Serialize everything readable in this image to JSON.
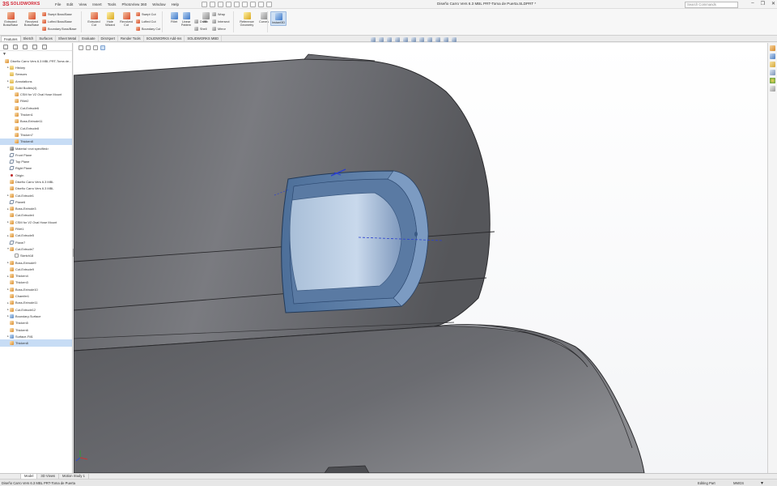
{
  "app": {
    "brand": "SOLIDWORKS",
    "document_title": "Diseño Carro Vers 6.3 MBL PRT-Toma de Puerta.SLDPRT *",
    "search_placeholder": "Search Commands",
    "win_minimize": "–",
    "win_restore": "❐",
    "win_close": "✕",
    "accent_color": "#d2202f"
  },
  "menu": [
    "File",
    "Edit",
    "View",
    "Insert",
    "Tools",
    "PhotoView 360",
    "Window",
    "Help"
  ],
  "ribbon": {
    "buttons": [
      {
        "label": "Extruded Boss/Base",
        "icon": "extrude-boss-icon"
      },
      {
        "label": "Revolved Boss/Base",
        "icon": "revolve-boss-icon"
      },
      {
        "label": "Extruded Cut",
        "icon": "extrude-cut-icon"
      },
      {
        "label": "Hole Wizard",
        "icon": "hole-wizard-icon"
      },
      {
        "label": "Revolved Cut",
        "icon": "revolve-cut-icon"
      },
      {
        "label": "Fillet",
        "icon": "fillet-icon"
      },
      {
        "label": "Linear Pattern",
        "icon": "linear-pattern-icon"
      },
      {
        "label": "Rib",
        "icon": "rib-icon"
      },
      {
        "label": "Reference Geometry",
        "icon": "reference-geometry-icon"
      },
      {
        "label": "Curves",
        "icon": "curves-icon"
      },
      {
        "label": "Instant3D",
        "icon": "instant3d-icon"
      }
    ],
    "small": [
      {
        "label": "Swept Boss/Base",
        "icon": "swept-boss-icon"
      },
      {
        "label": "Lofted Boss/Base",
        "icon": "lofted-boss-icon"
      },
      {
        "label": "Boundary Boss/Base",
        "icon": "boundary-boss-icon"
      },
      {
        "label": "Swept Cut",
        "icon": "swept-cut-icon"
      },
      {
        "label": "Lofted Cut",
        "icon": "lofted-cut-icon"
      },
      {
        "label": "Boundary Cut",
        "icon": "boundary-cut-icon"
      },
      {
        "label": "Draft",
        "icon": "draft-icon"
      },
      {
        "label": "Shell",
        "icon": "shell-icon"
      },
      {
        "label": "Wrap",
        "icon": "wrap-icon"
      },
      {
        "label": "Intersect",
        "icon": "intersect-icon"
      },
      {
        "label": "Mirror",
        "icon": "mirror-icon"
      }
    ]
  },
  "tabs": [
    "Features",
    "Sketch",
    "Surfaces",
    "Sheet Metal",
    "Evaluate",
    "DimXpert",
    "Render Tools",
    "SOLIDWORKS Add-Ins",
    "SOLIDWORKS MBD"
  ],
  "tree": {
    "filter_icon": "filter-icon",
    "rows": [
      {
        "label": "Diseño Carro Vers 6.3 MBL PRT-Toma de...",
        "indent": 0,
        "icon": "part",
        "exp": "",
        "selected": false
      },
      {
        "label": "History",
        "indent": 1,
        "icon": "folder",
        "exp": "▸",
        "selected": false
      },
      {
        "label": "Sensors",
        "indent": 1,
        "icon": "folder",
        "exp": "",
        "selected": false
      },
      {
        "label": "Annotations",
        "indent": 1,
        "icon": "folder",
        "exp": "▸",
        "selected": false
      },
      {
        "label": "Solid Bodies(4)",
        "indent": 1,
        "icon": "folder",
        "exp": "▾",
        "selected": false
      },
      {
        "label": "CSM for V2 Oval Hose Mount",
        "indent": 2,
        "icon": "feat",
        "exp": "",
        "selected": false
      },
      {
        "label": "Fillet2",
        "indent": 2,
        "icon": "feat",
        "exp": "",
        "selected": false
      },
      {
        "label": "Cut-Extrude6",
        "indent": 2,
        "icon": "feat",
        "exp": "",
        "selected": false
      },
      {
        "label": "Thicken1",
        "indent": 2,
        "icon": "feat",
        "exp": "",
        "selected": false
      },
      {
        "label": "Boss-Extrude11",
        "indent": 2,
        "icon": "feat",
        "exp": "",
        "selected": false
      },
      {
        "label": "Cut-Extrude8",
        "indent": 2,
        "icon": "feat",
        "exp": "",
        "selected": false
      },
      {
        "label": "Thicken7",
        "indent": 2,
        "icon": "feat",
        "exp": "",
        "selected": false
      },
      {
        "label": "Thicken8",
        "indent": 2,
        "icon": "feat",
        "exp": "",
        "selected": true
      },
      {
        "label": "Material <not specified>",
        "indent": 1,
        "icon": "mat",
        "exp": "",
        "selected": false
      },
      {
        "label": "Front Plane",
        "indent": 1,
        "icon": "plane",
        "exp": "",
        "selected": false
      },
      {
        "label": "Top Plane",
        "indent": 1,
        "icon": "plane",
        "exp": "",
        "selected": false
      },
      {
        "label": "Right Plane",
        "indent": 1,
        "icon": "plane",
        "exp": "",
        "selected": false
      },
      {
        "label": "Origin",
        "indent": 1,
        "icon": "origin",
        "exp": "",
        "selected": false
      },
      {
        "label": "Diseño Carro Vers 6.3 MBL",
        "indent": 1,
        "icon": "feat",
        "exp": "",
        "selected": false
      },
      {
        "label": "Diseño Carro Vers 6.3 MBL",
        "indent": 1,
        "icon": "feat",
        "exp": "",
        "selected": false
      },
      {
        "label": "Cut-Extrude1",
        "indent": 1,
        "icon": "feat",
        "exp": "▸",
        "selected": false
      },
      {
        "label": "Plane6",
        "indent": 1,
        "icon": "plane",
        "exp": "",
        "selected": false
      },
      {
        "label": "Boss-Extrude3",
        "indent": 1,
        "icon": "feat",
        "exp": "▸",
        "selected": false
      },
      {
        "label": "Cut-Extrude4",
        "indent": 1,
        "icon": "feat",
        "exp": "",
        "selected": false
      },
      {
        "label": "CSM for V2 Oval Hose Mount",
        "indent": 1,
        "icon": "feat",
        "exp": "▸",
        "selected": false
      },
      {
        "label": "Fillet1",
        "indent": 1,
        "icon": "feat",
        "exp": "",
        "selected": false
      },
      {
        "label": "Cut-Extrude5",
        "indent": 1,
        "icon": "feat",
        "exp": "▸",
        "selected": false
      },
      {
        "label": "Plane7",
        "indent": 1,
        "icon": "plane",
        "exp": "",
        "selected": false
      },
      {
        "label": "Cut-Extrude7",
        "indent": 1,
        "icon": "feat",
        "exp": "▾",
        "selected": false
      },
      {
        "label": "Sketch18",
        "indent": 2,
        "icon": "sketch",
        "exp": "",
        "selected": false
      },
      {
        "label": "Boss-Extrude9",
        "indent": 1,
        "icon": "feat",
        "exp": "▸",
        "selected": false
      },
      {
        "label": "Cut-Extrude9",
        "indent": 1,
        "icon": "feat",
        "exp": "",
        "selected": false
      },
      {
        "label": "Thicken4",
        "indent": 1,
        "icon": "feat",
        "exp": "▸",
        "selected": false
      },
      {
        "label": "Thicken3",
        "indent": 1,
        "icon": "feat",
        "exp": "",
        "selected": false
      },
      {
        "label": "Boss-Extrude10",
        "indent": 1,
        "icon": "feat",
        "exp": "▸",
        "selected": false
      },
      {
        "label": "Chamfer1",
        "indent": 1,
        "icon": "feat",
        "exp": "",
        "selected": false
      },
      {
        "label": "Boss-Extrude11",
        "indent": 1,
        "icon": "feat",
        "exp": "▸",
        "selected": false
      },
      {
        "label": "Cut-Extrude12",
        "indent": 1,
        "icon": "feat",
        "exp": "▸",
        "selected": false
      },
      {
        "label": "Boundary-Surface",
        "indent": 1,
        "icon": "surf",
        "exp": "▸",
        "selected": false
      },
      {
        "label": "Thicken5",
        "indent": 1,
        "icon": "feat",
        "exp": "",
        "selected": false
      },
      {
        "label": "Thicken6",
        "indent": 1,
        "icon": "feat",
        "exp": "",
        "selected": false
      },
      {
        "label": "Surface-Fill1",
        "indent": 1,
        "icon": "surf",
        "exp": "▸",
        "selected": false
      },
      {
        "label": "Thicken8",
        "indent": 1,
        "icon": "feat",
        "exp": "",
        "selected": true
      }
    ]
  },
  "bottom_tabs": [
    "Model",
    "3D Views",
    "Motion Study 1"
  ],
  "status": {
    "left": "Diseño Carro Vers 6.3 MBL PRT-Toma de Puerta",
    "editing": "Editing Part",
    "units": "MMGS",
    "arrow": "▾"
  }
}
